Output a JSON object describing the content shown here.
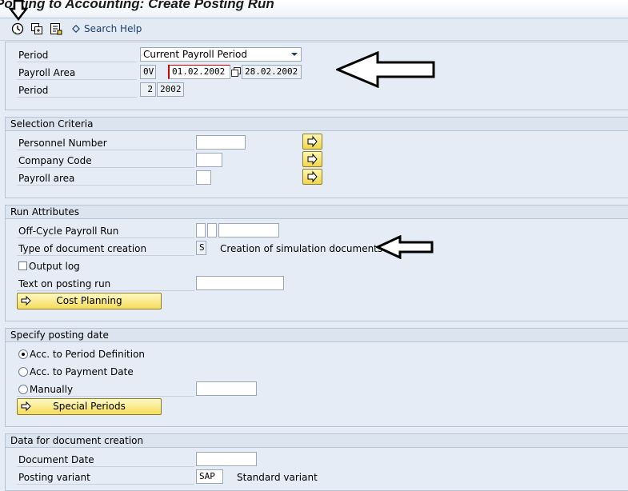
{
  "window": {
    "title": "Posting to Accounting: Create Posting Run"
  },
  "toolbar": {
    "execute_icon": "execute-clock-icon",
    "variant_icon": "get-variant-icon",
    "save_icon": "save-variant-icon",
    "search_help_label": "Search Help"
  },
  "period_section": {
    "period_label": "Period",
    "period_select_value": "Current Payroll Period",
    "payroll_area_label": "Payroll Area",
    "payroll_area_value": "0V",
    "date_from": "01.02.2002",
    "date_to": "28.02.2002",
    "period2_label": "Period",
    "period_number": "2",
    "period_year": "2002"
  },
  "selection_criteria": {
    "title": "Selection Criteria",
    "personnel_number_label": "Personnel Number",
    "company_code_label": "Company Code",
    "payroll_area_label": "Payroll area"
  },
  "run_attributes": {
    "title": "Run Attributes",
    "offcycle_label": "Off-Cycle Payroll Run",
    "doc_creation_label": "Type of document creation",
    "doc_creation_value": "S",
    "doc_creation_text": "Creation of simulation documents",
    "output_log_label": "Output log",
    "text_posting_run_label": "Text on posting run",
    "cost_planning_label": "Cost Planning"
  },
  "posting_date": {
    "title": "Specify posting date",
    "option_period_def": "Acc. to Period Definition",
    "option_payment_date": "Acc. to Payment Date",
    "option_manually": "Manually",
    "special_periods_label": "Special Periods",
    "selected_option": "Acc. to Period Definition"
  },
  "document_creation": {
    "title": "Data for document creation",
    "document_date_label": "Document Date",
    "posting_variant_label": "Posting variant",
    "posting_variant_value": "SAP",
    "posting_variant_text": "Standard variant"
  },
  "colors": {
    "background": "#e5ecf5",
    "button_yellow": "#f4dc5c",
    "required_marker": "#d40000"
  }
}
